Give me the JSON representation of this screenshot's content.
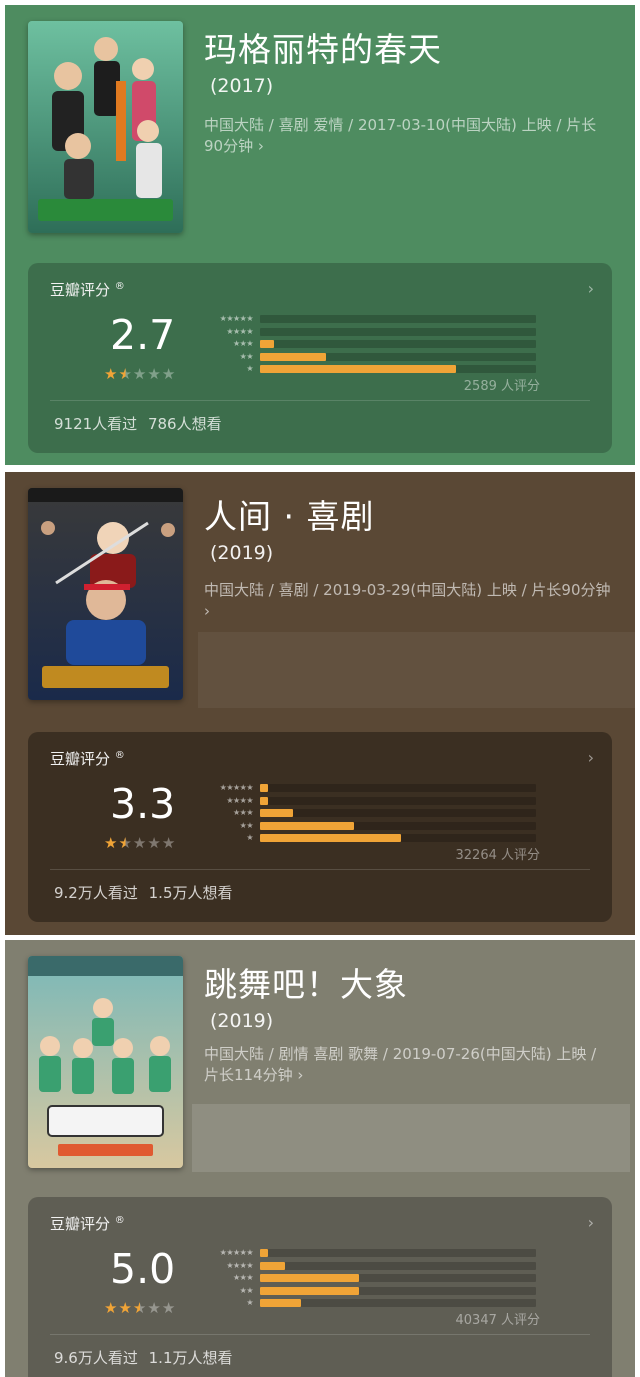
{
  "movies": [
    {
      "title": "玛格丽特的春天",
      "year": "(2017)",
      "meta": "中国大陆 / 喜剧 爱情 / 2017-03-10(中国大陆) 上映 / 片长90分钟 ›",
      "poster_icon": "movie-poster-image",
      "rating_label": "豆瓣评分",
      "rating_mark": "®",
      "score": "2.7",
      "stars_full": 1,
      "stars_half": 1,
      "distribution": [
        0.0,
        0.0,
        0.05,
        0.24,
        0.71
      ],
      "count": "2589 人评分",
      "watched": "9121人看过",
      "wish": "786人想看",
      "colors": {
        "panel": "#4e8c60",
        "card": "#3d6e4c"
      }
    },
    {
      "title": "人间 · 喜剧",
      "year": "(2019)",
      "meta": "中国大陆 / 喜剧 / 2019-03-29(中国大陆) 上映 / 片长90分钟 ›",
      "poster_icon": "movie-poster-image",
      "rating_label": "豆瓣评分",
      "rating_mark": "®",
      "score": "3.3",
      "stars_full": 1,
      "stars_half": 1,
      "distribution": [
        0.03,
        0.03,
        0.12,
        0.34,
        0.51
      ],
      "count": "32264 人评分",
      "watched": "9.2万人看过",
      "wish": "1.5万人想看",
      "colors": {
        "panel": "#5a4835",
        "card": "#3b2f22"
      }
    },
    {
      "title": "跳舞吧！大象",
      "year": "(2019)",
      "meta": "中国大陆 / 剧情 喜剧 歌舞 / 2019-07-26(中国大陆) 上映 / 片长114分钟 ›",
      "poster_icon": "movie-poster-image",
      "rating_label": "豆瓣评分",
      "rating_mark": "®",
      "score": "5.0",
      "stars_full": 2,
      "stars_half": 1,
      "distribution": [
        0.03,
        0.09,
        0.36,
        0.36,
        0.15
      ],
      "count": "40347 人评分",
      "watched": "9.6万人看过",
      "wish": "1.1万人想看",
      "colors": {
        "panel": "#807f70",
        "card": "#5f5e54"
      }
    }
  ],
  "star_labels": [
    "★★★★★",
    "★★★★",
    "★★★",
    "★★",
    "★"
  ],
  "chevron_icon": "chevron-right-icon"
}
